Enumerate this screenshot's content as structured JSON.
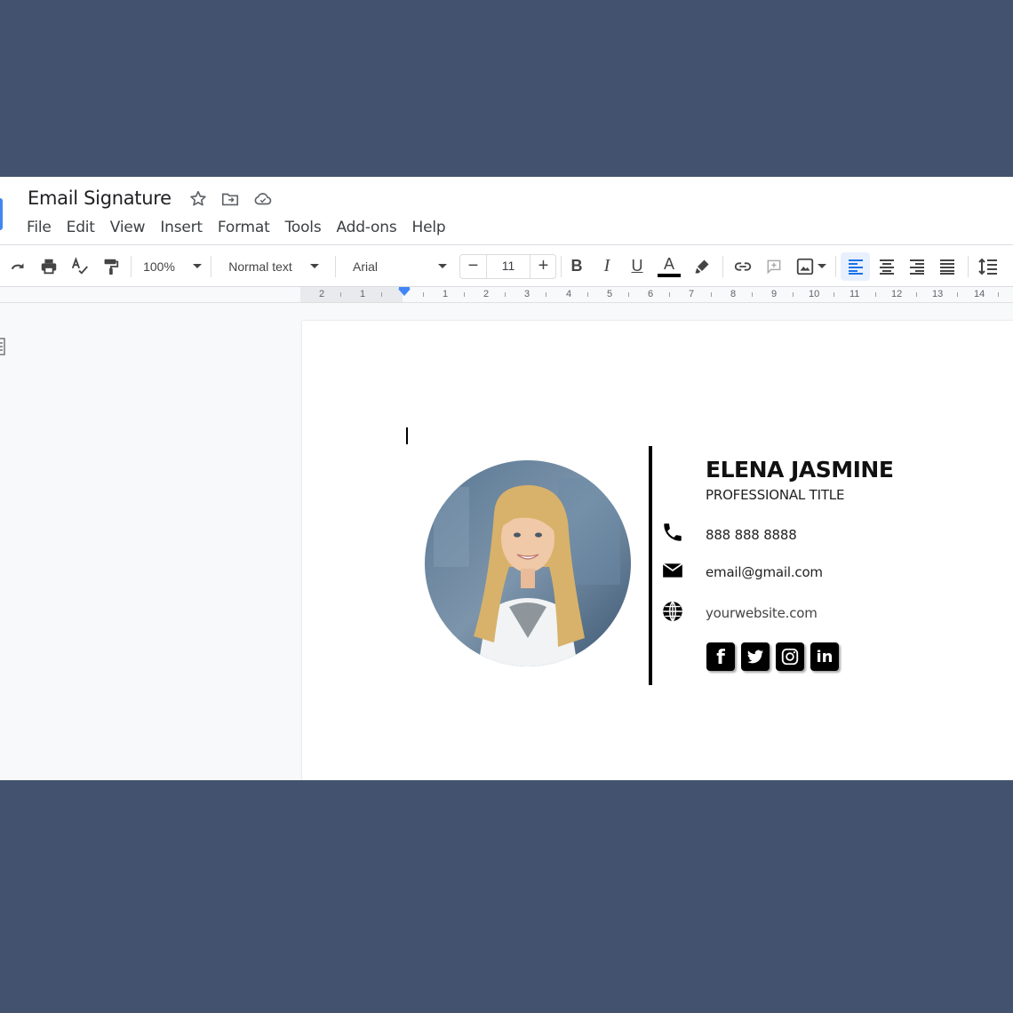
{
  "document": {
    "title": "Email Signature"
  },
  "menu": {
    "items": [
      "File",
      "Edit",
      "View",
      "Insert",
      "Format",
      "Tools",
      "Add-ons",
      "Help"
    ]
  },
  "toolbar": {
    "zoom": "100%",
    "style": "Normal text",
    "font": "Arial",
    "font_size": "11",
    "decrease_label": "−",
    "increase_label": "+",
    "bold_label": "B",
    "italic_label": "I",
    "underline_label": "U",
    "text_color_label": "A",
    "icons": [
      "redo-icon",
      "print-icon",
      "spellcheck-icon",
      "paint-format-icon",
      "bold-icon",
      "italic-icon",
      "underline-icon",
      "text-color-icon",
      "highlight-icon",
      "link-icon",
      "comment-icon",
      "image-icon",
      "align-left-icon",
      "align-center-icon",
      "align-right-icon",
      "justify-icon",
      "line-spacing-icon"
    ]
  },
  "ruler": {
    "labels": [
      "2",
      "1",
      "1",
      "2",
      "3",
      "4",
      "5",
      "6",
      "7",
      "8",
      "9",
      "10",
      "11",
      "12",
      "13",
      "14"
    ]
  },
  "signature": {
    "name": "ELENA JASMINE",
    "title": "PROFESSIONAL TITLE",
    "phone": "888 888 8888",
    "email": "email@gmail.com",
    "website": "yourwebsite.com",
    "social": [
      "facebook-icon",
      "twitter-icon",
      "instagram-icon",
      "linkedin-icon"
    ],
    "linkedin_label": "in",
    "facebook_label": "f"
  },
  "colors": {
    "background": "#43536f",
    "accent": "#4285f4",
    "align_active": "#e8f0fe"
  }
}
